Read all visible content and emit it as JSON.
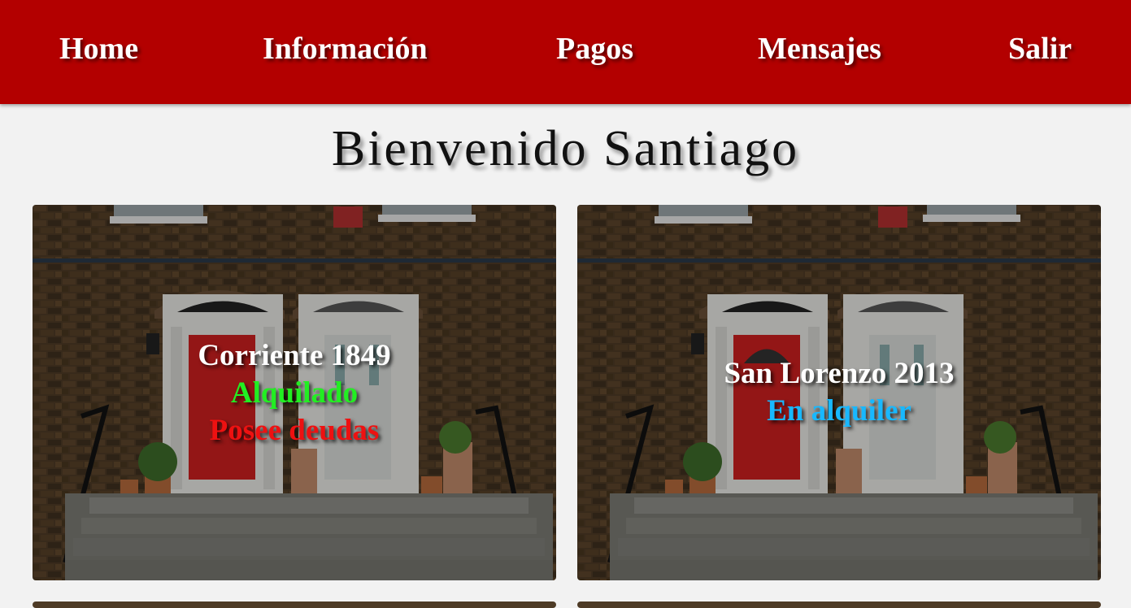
{
  "nav": {
    "home": "Home",
    "informacion": "Información",
    "pagos": "Pagos",
    "mensajes": "Mensajes",
    "salir": "Salir"
  },
  "welcome": "Bienvenido Santiago",
  "colors": {
    "navbar": "#b30000",
    "background": "#f2f2f2",
    "status_rented": "#22ee22",
    "status_debt": "#ee1111",
    "status_available": "#18b8ff"
  },
  "properties": [
    {
      "address": "Corriente 1849",
      "status": "Alquilado",
      "debt": "Posee deudas"
    },
    {
      "address": "San Lorenzo 2013",
      "status": "En alquiler"
    }
  ]
}
